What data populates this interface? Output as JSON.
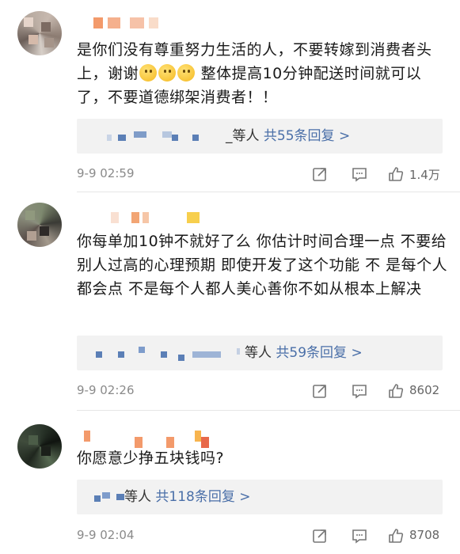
{
  "comments": [
    {
      "text_parts": [
        "是你们没有尊重努力生活的人，不要转嫁到消费者头上，谢谢",
        "整体提高10分钟配送时间就可以了，不要道德绑架消费者！！"
      ],
      "reply_suffix": "_等人",
      "reply_link": "共55条回复 >",
      "time": "9-9 02:59",
      "likes": "1.4万"
    },
    {
      "text": "你每单加10钟不就好了么 你估计时间合理一点 不要给别人过高的心理预期 即使开发了这个功能 不 是每个人都会点  不是每个人都人美心善你不如从根本上解决",
      "reply_suffix": "等人",
      "reply_link": "共59条回复 >",
      "time": "9-9 02:26",
      "likes": "8602"
    },
    {
      "text": "你愿意少挣五块钱吗?",
      "reply_suffix": "等人",
      "reply_link": "共118条回复 >",
      "time": "9-9 02:04",
      "likes": "8708"
    }
  ],
  "icons": [
    "share-icon",
    "comment-icon",
    "like-icon",
    "smile-emoji"
  ],
  "colors": {
    "link": "#4a6fa8",
    "meta": "#8a8a8a",
    "reply_bg": "#f2f2f2"
  }
}
